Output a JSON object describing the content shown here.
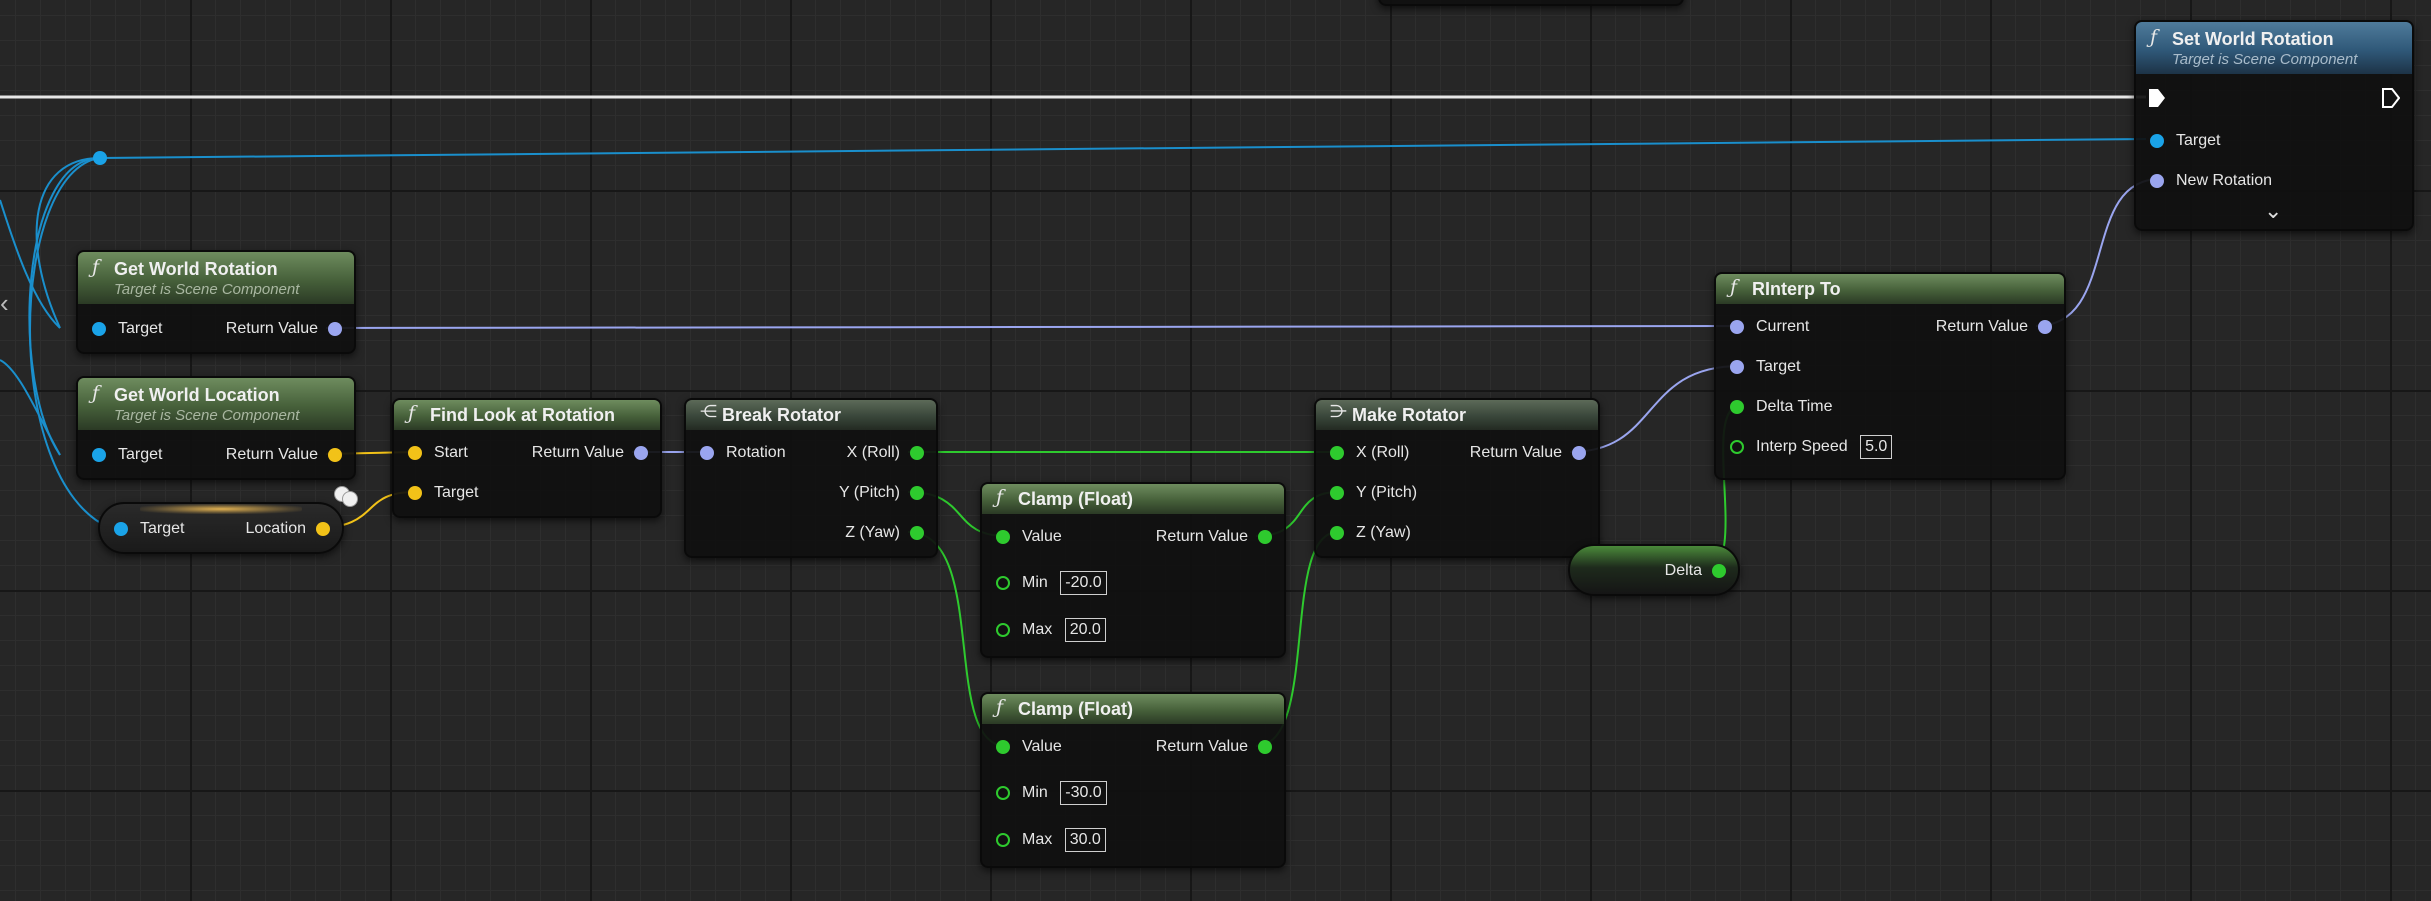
{
  "canvas": {
    "collapse_arrow": "‹",
    "expand_arrow": "⌄"
  },
  "nodes": {
    "set_world_rotation": {
      "title": "Set World Rotation",
      "subtitle": "Target is Scene Component",
      "target": "Target",
      "new_rotation": "New Rotation"
    },
    "get_world_rotation": {
      "title": "Get World Rotation",
      "subtitle": "Target is Scene Component",
      "target": "Target",
      "return_value": "Return Value"
    },
    "get_world_location": {
      "title": "Get World Location",
      "subtitle": "Target is Scene Component",
      "target": "Target",
      "return_value": "Return Value"
    },
    "target_var": {
      "target": "Target",
      "location": "Location"
    },
    "find_look_at": {
      "title": "Find Look at Rotation",
      "start": "Start",
      "target": "Target",
      "return_value": "Return Value"
    },
    "break_rotator": {
      "title": "Break Rotator",
      "rotation": "Rotation",
      "x": "X (Roll)",
      "y": "Y (Pitch)",
      "z": "Z (Yaw)"
    },
    "clamp1": {
      "title": "Clamp (Float)",
      "value": "Value",
      "return_value": "Return Value",
      "min_label": "Min",
      "min": "-20.0",
      "max_label": "Max",
      "max": "20.0"
    },
    "clamp2": {
      "title": "Clamp (Float)",
      "value": "Value",
      "return_value": "Return Value",
      "min_label": "Min",
      "min": "-30.0",
      "max_label": "Max",
      "max": "30.0"
    },
    "make_rotator": {
      "title": "Make Rotator",
      "x": "X (Roll)",
      "y": "Y (Pitch)",
      "z": "Z (Yaw)",
      "return_value": "Return Value"
    },
    "delta_var": {
      "label": "Delta"
    },
    "rinterp": {
      "title": "RInterp To",
      "current": "Current",
      "target": "Target",
      "delta_time": "Delta Time",
      "interp_speed": "Interp Speed",
      "interp_speed_value": "5.0",
      "return_value": "Return Value"
    }
  },
  "colors": {
    "object": "#1aa3e8",
    "rotator": "#9aa5ef",
    "vector": "#f2c218",
    "float": "#2eca2e",
    "exec": "#ffffff",
    "header_green": "#46603a",
    "header_blue": "#2f5878"
  }
}
